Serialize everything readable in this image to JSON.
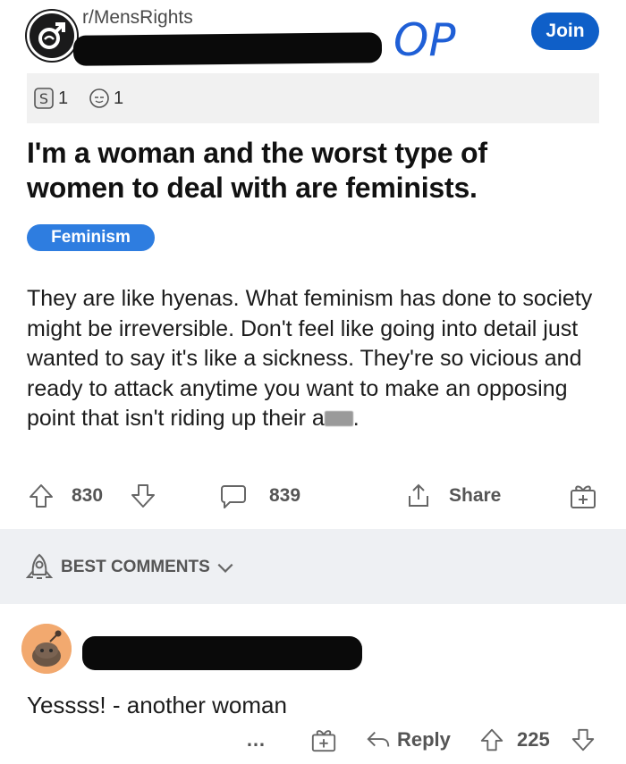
{
  "header": {
    "subreddit": "r/MensRights",
    "handwritten_mark": "OP",
    "join_label": "Join"
  },
  "awards": [
    {
      "icon": "silver-award-icon",
      "count": "1"
    },
    {
      "icon": "helpful-award-icon",
      "count": "1"
    }
  ],
  "post": {
    "title": "I'm a woman and the worst type of women to deal with are feminists.",
    "flair": "Feminism",
    "body": "They are like hyenas. What feminism has done to society might be irreversible. Don't feel like going into detail just wanted to say it's like a sickness. They're so vicious and ready to attack anytime you want to make an opposing point that isn't riding up their a",
    "body_end": "."
  },
  "actions": {
    "upvotes": "830",
    "comments": "839",
    "share_label": "Share"
  },
  "sort": {
    "label": "BEST COMMENTS"
  },
  "comment": {
    "text": "Yessss! - another woman",
    "more_label": "…",
    "reply_label": "Reply",
    "votes": "225"
  },
  "colors": {
    "accent": "#0f5fc8",
    "flair_bg": "#2e7de0",
    "op_ink": "#1f5fd6",
    "avatar_bg": "#f2a96f"
  }
}
